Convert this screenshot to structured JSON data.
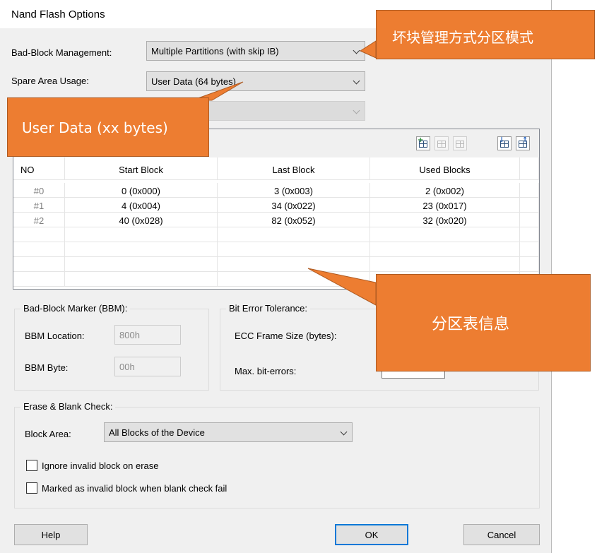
{
  "dialog": {
    "title": "Nand Flash Options"
  },
  "bad_block_management": {
    "label": "Bad-Block Management:",
    "value": "Multiple Partitions (with skip IB)"
  },
  "spare_area_usage": {
    "label": "Spare Area Usage:",
    "value": "User Data (64 bytes)"
  },
  "partition_table": {
    "columns": [
      "NO",
      "Start Block",
      "Last Block",
      "Used Blocks"
    ],
    "rows": [
      {
        "no": "#0",
        "start": "0 (0x000)",
        "last": "3 (0x003)",
        "used": "2 (0x002)"
      },
      {
        "no": "#1",
        "start": "4 (0x004)",
        "last": "34 (0x022)",
        "used": "23 (0x017)"
      },
      {
        "no": "#2",
        "start": "40 (0x028)",
        "last": "82 (0x052)",
        "used": "32 (0x020)"
      }
    ]
  },
  "bbm": {
    "title": "Bad-Block Marker (BBM):",
    "location_label": "BBM Location:",
    "location_value": "800h",
    "byte_label": "BBM Byte:",
    "byte_value": "00h"
  },
  "bit_error": {
    "title": "Bit Error Tolerance:",
    "ecc_label": "ECC Frame Size (bytes):",
    "max_label": "Max. bit-errors:"
  },
  "erase": {
    "title": "Erase & Blank Check:",
    "block_area_label": "Block Area:",
    "block_area_value": "All Blocks of the Device",
    "ignore_invalid_label": "Ignore invalid block on erase",
    "mark_invalid_label": "Marked as invalid block when blank check fail"
  },
  "buttons": {
    "help": "Help",
    "ok": "OK",
    "cancel": "Cancel"
  },
  "callouts": {
    "top": "坏块管理方式分区模式",
    "user_data": "User Data (xx bytes)",
    "table_info": "分区表信息"
  },
  "colors": {
    "callout": "#ed7d31",
    "accent": "#0078d7"
  }
}
